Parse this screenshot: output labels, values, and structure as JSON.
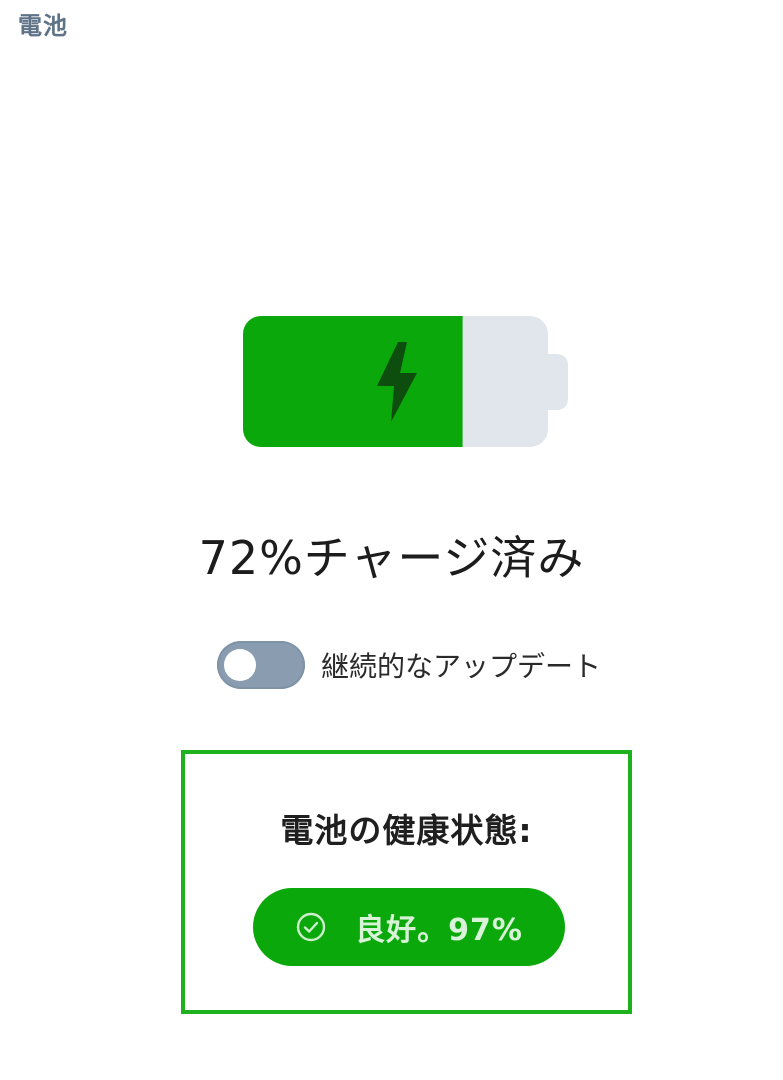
{
  "page": {
    "title": "電池"
  },
  "battery": {
    "charge_percent": 72,
    "status_text": "72%チャージ済み",
    "charging": true,
    "colors": {
      "fill": "#0aa80a",
      "empty": "#e1e6ec",
      "bolt": "#0d4d0d"
    },
    "icon": "charging-bolt-icon"
  },
  "continuous_update": {
    "label": "継続的なアップデート",
    "enabled": false
  },
  "health": {
    "title": "電池の健康状態:",
    "value": "良好。97%",
    "icon": "check-circle-icon",
    "accent": "#1db21d"
  }
}
